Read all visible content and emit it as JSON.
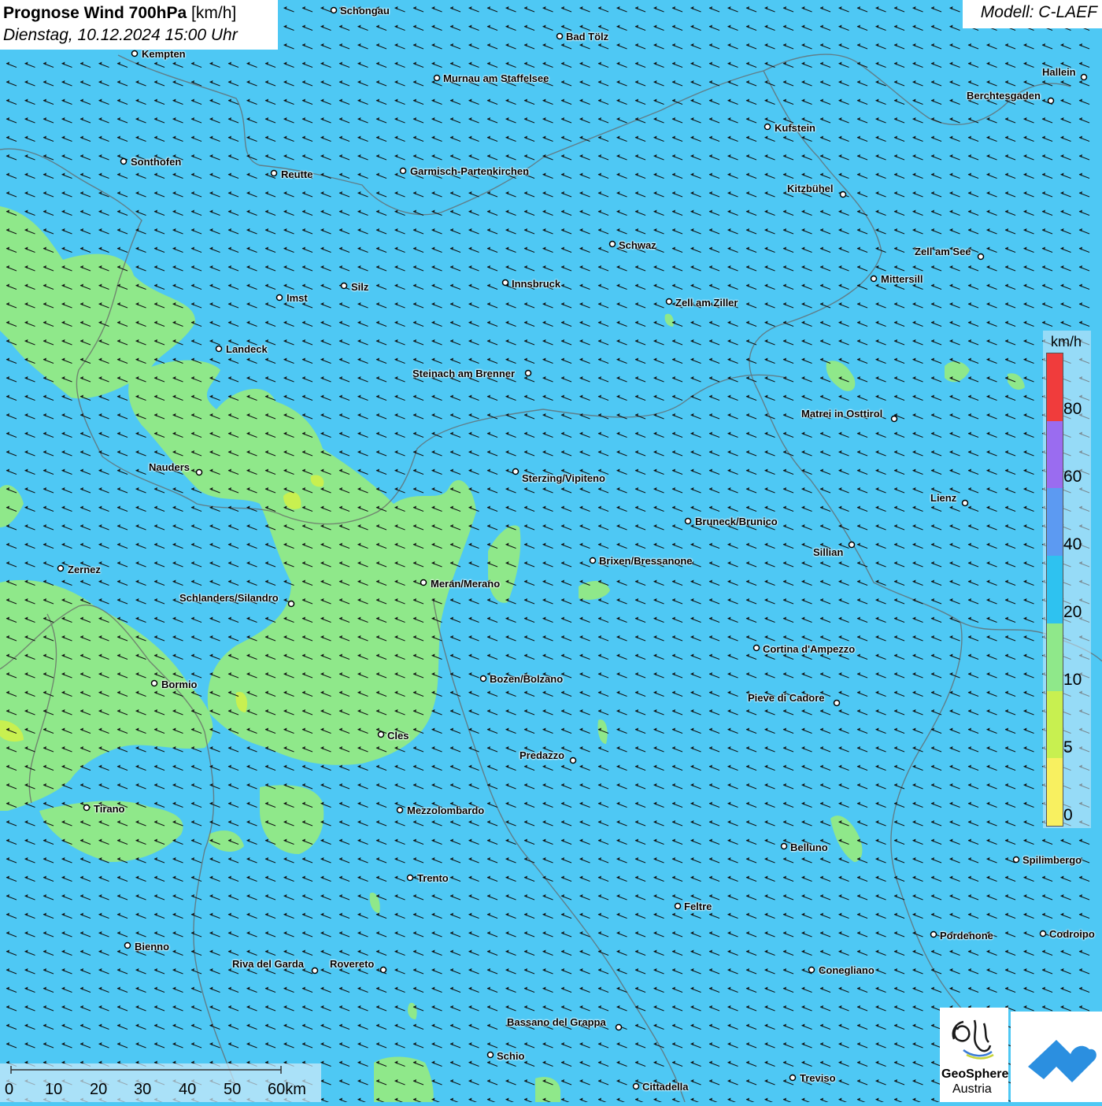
{
  "title": {
    "bold": "Prognose Wind 700hPa",
    "unit": "[km/h]",
    "datetime": "Dienstag, 10.12.2024 15:00 Uhr"
  },
  "model": "Modell: C-LAEF",
  "legend": {
    "unit": "km/h",
    "labels": [
      "80",
      "60",
      "40",
      "20",
      "10",
      "5",
      "0"
    ],
    "colors": [
      "#f03c3c",
      "#9a6cf0",
      "#5c9af2",
      "#2ec2f0",
      "#8fe88a",
      "#c8f050",
      "#f8f060"
    ]
  },
  "scalebar": {
    "ticks": [
      "0",
      "10",
      "20",
      "30",
      "40",
      "50",
      "60km"
    ]
  },
  "logos": {
    "geosphere_line1": "GeoSphere",
    "geosphere_line2": "Austria"
  },
  "cities": [
    {
      "name": "Schongau"
    },
    {
      "name": "Bad Tölz"
    },
    {
      "name": "Kempten"
    },
    {
      "name": "Murnau am Staffelsee"
    },
    {
      "name": "Hallein"
    },
    {
      "name": "Berchtesgaden"
    },
    {
      "name": "Kufstein"
    },
    {
      "name": "Sonthofen"
    },
    {
      "name": "Reutte"
    },
    {
      "name": "Garmisch-Partenkirchen"
    },
    {
      "name": "Kitzbühel"
    },
    {
      "name": "Schwaz"
    },
    {
      "name": "Zell am See"
    },
    {
      "name": "Mittersill"
    },
    {
      "name": "Silz"
    },
    {
      "name": "Innsbruck"
    },
    {
      "name": "Imst"
    },
    {
      "name": "Zell am Ziller"
    },
    {
      "name": "Landeck"
    },
    {
      "name": "Steinach am Brenner"
    },
    {
      "name": "Matrei in Osttirol"
    },
    {
      "name": "Nauders"
    },
    {
      "name": "Sterzing/Vipiteno"
    },
    {
      "name": "Lienz"
    },
    {
      "name": "Bruneck/Brunico"
    },
    {
      "name": "Sillian"
    },
    {
      "name": "Brixen/Bressanone"
    },
    {
      "name": "Zernez"
    },
    {
      "name": "Meran/Merano"
    },
    {
      "name": "Schlanders/Silandro"
    },
    {
      "name": "Cortina d'Ampezzo"
    },
    {
      "name": "Bozen/Bolzano"
    },
    {
      "name": "Bormio"
    },
    {
      "name": "Pieve di Cadore"
    },
    {
      "name": "Cles"
    },
    {
      "name": "Predazzo"
    },
    {
      "name": "Tirano"
    },
    {
      "name": "Mezzolombardo"
    },
    {
      "name": "Belluno"
    },
    {
      "name": "Spilimbergo"
    },
    {
      "name": "Trento"
    },
    {
      "name": "Feltre"
    },
    {
      "name": "Pordenone"
    },
    {
      "name": "Codroipo"
    },
    {
      "name": "Bienno"
    },
    {
      "name": "Riva del Garda"
    },
    {
      "name": "Rovereto"
    },
    {
      "name": "Conegliano"
    },
    {
      "name": "Bassano del Grappa"
    },
    {
      "name": "Schio"
    },
    {
      "name": "Treviso"
    },
    {
      "name": "Cittadella"
    }
  ],
  "colors": {
    "wind_10_20": "#4ec8f4",
    "wind_5_10": "#8fe88a"
  }
}
